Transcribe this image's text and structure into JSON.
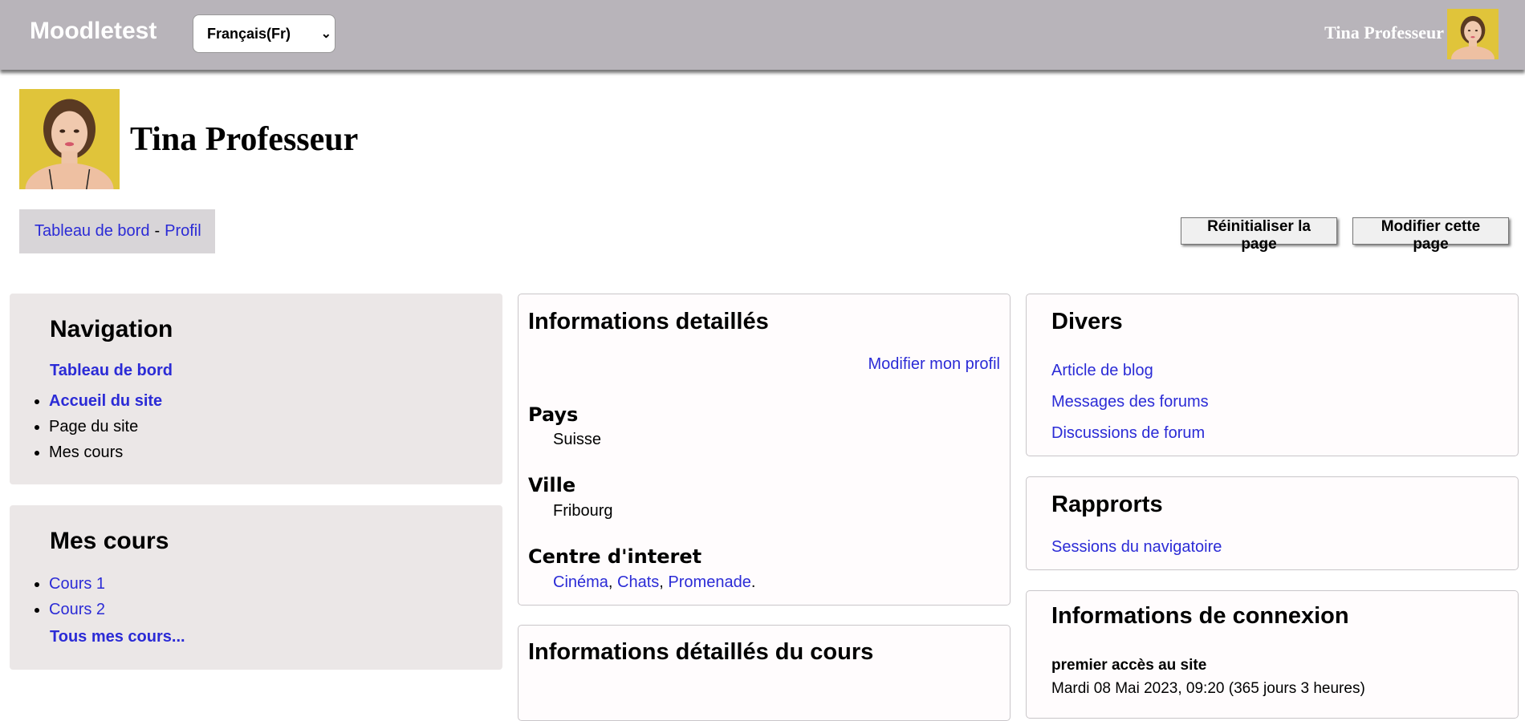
{
  "header": {
    "brand": "Moodletest",
    "language": "Français(Fr)",
    "user_name": "Tina Professeur"
  },
  "page": {
    "title": "Tina Professeur"
  },
  "breadcrumb": {
    "items": [
      "Tableau de bord",
      "Profil"
    ],
    "separator": "-"
  },
  "actions": {
    "reset": "Réinitialiser la page",
    "edit": "Modifier cette page"
  },
  "navigation": {
    "title": "Navigation",
    "dashboard": "Tableau de bord",
    "items": [
      "Accueil du site",
      "Page du site",
      "Mes cours"
    ]
  },
  "my_courses": {
    "title": "Mes cours",
    "items": [
      "Cours 1",
      "Cours 2"
    ],
    "all": "Tous mes cours..."
  },
  "details": {
    "title": "Informations detaillés",
    "edit_profile": "Modifier mon profil",
    "country_label": "Pays",
    "country": "Suisse",
    "city_label": "Ville",
    "city": "Fribourg",
    "interests_label": "Centre d'interet",
    "interests": [
      "Cinéma",
      "Chats",
      "Promenade"
    ],
    "interests_sep": ",",
    "interests_end": "."
  },
  "course_details": {
    "title": "Informations détaillés du cours"
  },
  "misc": {
    "title": "Divers",
    "items": [
      "Article de blog",
      "Messages des forums",
      "Discussions de forum"
    ]
  },
  "reports": {
    "title": "Rapprorts",
    "items": [
      "Sessions du navigatoire"
    ]
  },
  "login": {
    "title": "Informations de connexion",
    "first_access_label": "premier accès au site",
    "first_access_value": "Mardi 08 Mai 2023, 09:20 (365 jours 3 heures)"
  },
  "colors": {
    "header_bg": "#b8b4ba",
    "link": "#2b2bd6",
    "grey_block": "#ebe7e7",
    "breadcrumb_bg": "#d8d5d8"
  }
}
